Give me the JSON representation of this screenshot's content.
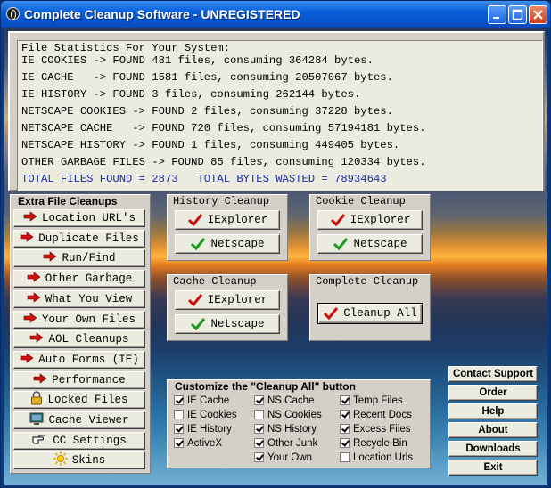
{
  "window": {
    "title": "Complete Cleanup Software - UNREGISTERED"
  },
  "stats": {
    "header": "File Statistics For Your System:",
    "lines": [
      "IE COOKIES -> FOUND 481 files, consuming 364284 bytes.",
      "IE CACHE   -> FOUND 1581 files, consuming 20507067 bytes.",
      "IE HISTORY -> FOUND 3 files, consuming 262144 bytes.",
      "NETSCAPE COOKIES -> FOUND 2 files, consuming 37228 bytes.",
      "NETSCAPE CACHE   -> FOUND 720 files, consuming 57194181 bytes.",
      "NETSCAPE HISTORY -> FOUND 1 files, consuming 449405 bytes.",
      "OTHER GARBAGE FILES -> FOUND 85 files, consuming 120334 bytes."
    ],
    "total": "TOTAL FILES FOUND = 2873   TOTAL BYTES WASTED = 78934643"
  },
  "extra": {
    "title": "Extra File Cleanups",
    "buttons": [
      {
        "label": "Location URL's",
        "icon": "red-arrow-icon"
      },
      {
        "label": "Duplicate Files",
        "icon": "red-arrow-icon"
      },
      {
        "label": "Run/Find",
        "icon": "red-arrow-icon"
      },
      {
        "label": "Other Garbage",
        "icon": "red-arrow-icon"
      },
      {
        "label": "What You View",
        "icon": "red-arrow-icon"
      },
      {
        "label": "Your Own Files",
        "icon": "red-arrow-icon"
      },
      {
        "label": "AOL Cleanups",
        "icon": "red-arrow-icon"
      },
      {
        "label": "Auto Forms (IE)",
        "icon": "red-arrow-icon"
      },
      {
        "label": "Performance",
        "icon": "red-arrow-icon"
      },
      {
        "label": "Locked Files",
        "icon": "padlock-icon"
      },
      {
        "label": "Cache Viewer",
        "icon": "monitor-icon"
      },
      {
        "label": "CC Settings",
        "icon": "pointing-hand-icon"
      },
      {
        "label": "Skins",
        "icon": "sun-icon"
      }
    ]
  },
  "history": {
    "title": "History Cleanup",
    "ie": "IExplorer",
    "ns": "Netscape"
  },
  "cookie": {
    "title": "Cookie Cleanup",
    "ie": "IExplorer",
    "ns": "Netscape"
  },
  "cache": {
    "title": "Cache Cleanup",
    "ie": "IExplorer",
    "ns": "Netscape"
  },
  "complete": {
    "title": "Complete Cleanup",
    "button": "Cleanup All"
  },
  "customize": {
    "title": "Customize the \"Cleanup All\" button",
    "col1": [
      {
        "label": "IE Cache",
        "checked": true
      },
      {
        "label": "IE Cookies",
        "checked": false
      },
      {
        "label": "IE History",
        "checked": true
      },
      {
        "label": "ActiveX",
        "checked": true
      }
    ],
    "col2": [
      {
        "label": "NS Cache",
        "checked": true
      },
      {
        "label": "NS Cookies",
        "checked": false
      },
      {
        "label": "NS History",
        "checked": true
      },
      {
        "label": "Other Junk",
        "checked": true
      },
      {
        "label": "Your Own",
        "checked": true
      }
    ],
    "col3": [
      {
        "label": "Temp Files",
        "checked": true
      },
      {
        "label": "Recent Docs",
        "checked": true
      },
      {
        "label": "Excess Files",
        "checked": true
      },
      {
        "label": "Recycle Bin",
        "checked": true
      },
      {
        "label": "Location Urls",
        "checked": false
      }
    ]
  },
  "side": {
    "buttons": [
      "Contact Support",
      "Order",
      "Help",
      "About",
      "Downloads",
      "Exit"
    ]
  },
  "colors": {
    "total_text": "#1a2aa8",
    "check_red": "#cc1010",
    "check_green": "#1a9a1a",
    "arrow_red": "#cc1010"
  }
}
